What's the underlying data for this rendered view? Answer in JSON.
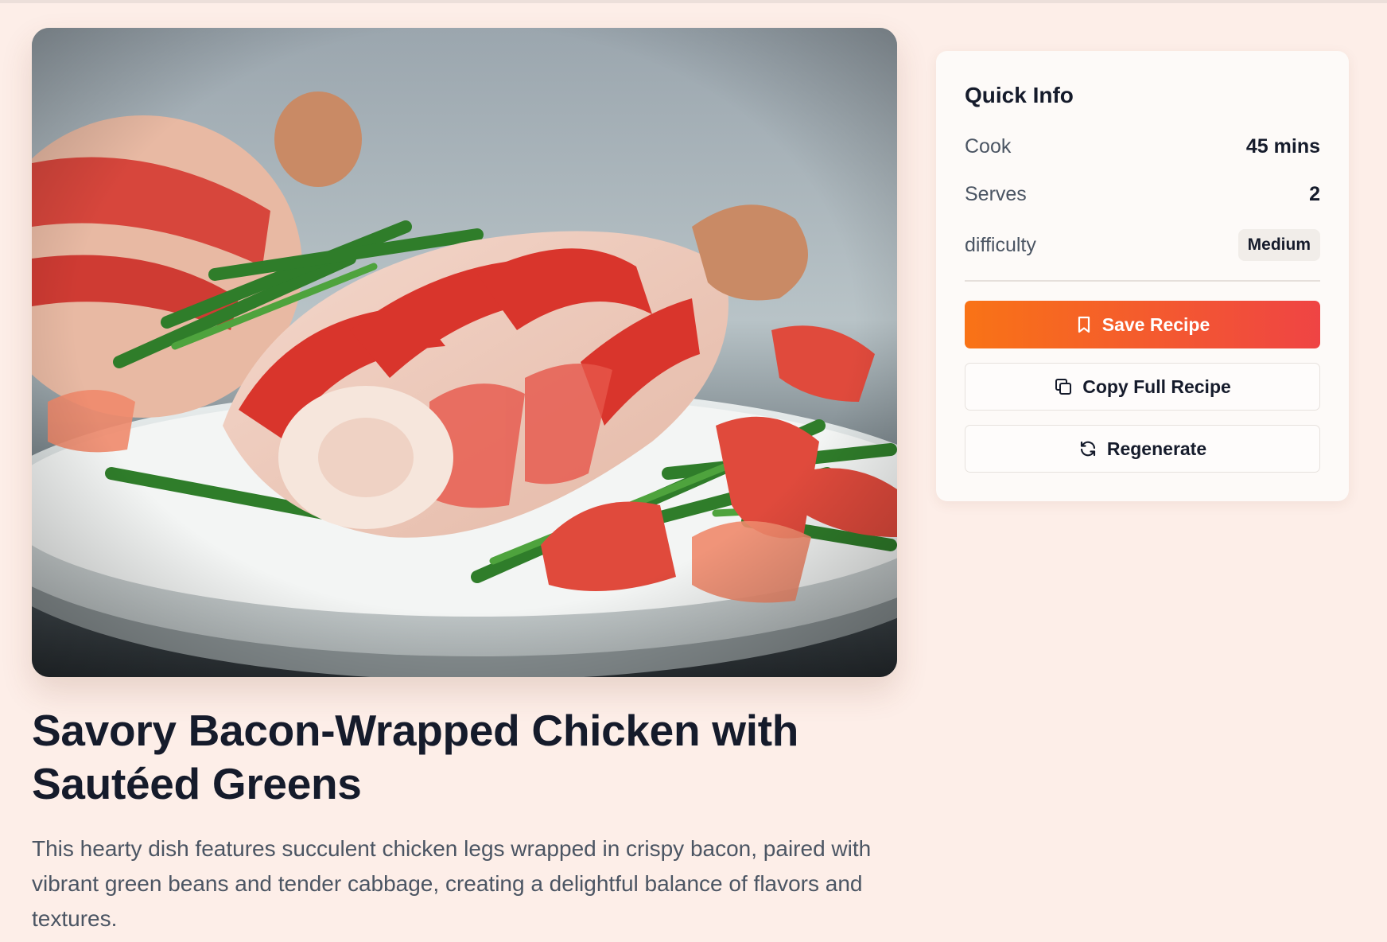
{
  "recipe": {
    "title": "Savory Bacon-Wrapped Chicken with Sautéed Greens",
    "description": "This hearty dish features succulent chicken legs wrapped in crispy bacon, paired with vibrant green beans and tender cabbage, creating a delightful balance of flavors and textures."
  },
  "quick_info": {
    "heading": "Quick Info",
    "cook_label": "Cook",
    "cook_value": "45 mins",
    "serves_label": "Serves",
    "serves_value": "2",
    "difficulty_label": "difficulty",
    "difficulty_value": "Medium"
  },
  "actions": {
    "save_label": "Save Recipe",
    "save_icon": "bookmark-icon",
    "copy_label": "Copy Full Recipe",
    "copy_icon": "copy-icon",
    "regenerate_label": "Regenerate",
    "regenerate_icon": "refresh-icon"
  },
  "colors": {
    "page_background": "#fdeee8",
    "primary_gradient_start": "#f97316",
    "primary_gradient_end": "#ef4444"
  }
}
